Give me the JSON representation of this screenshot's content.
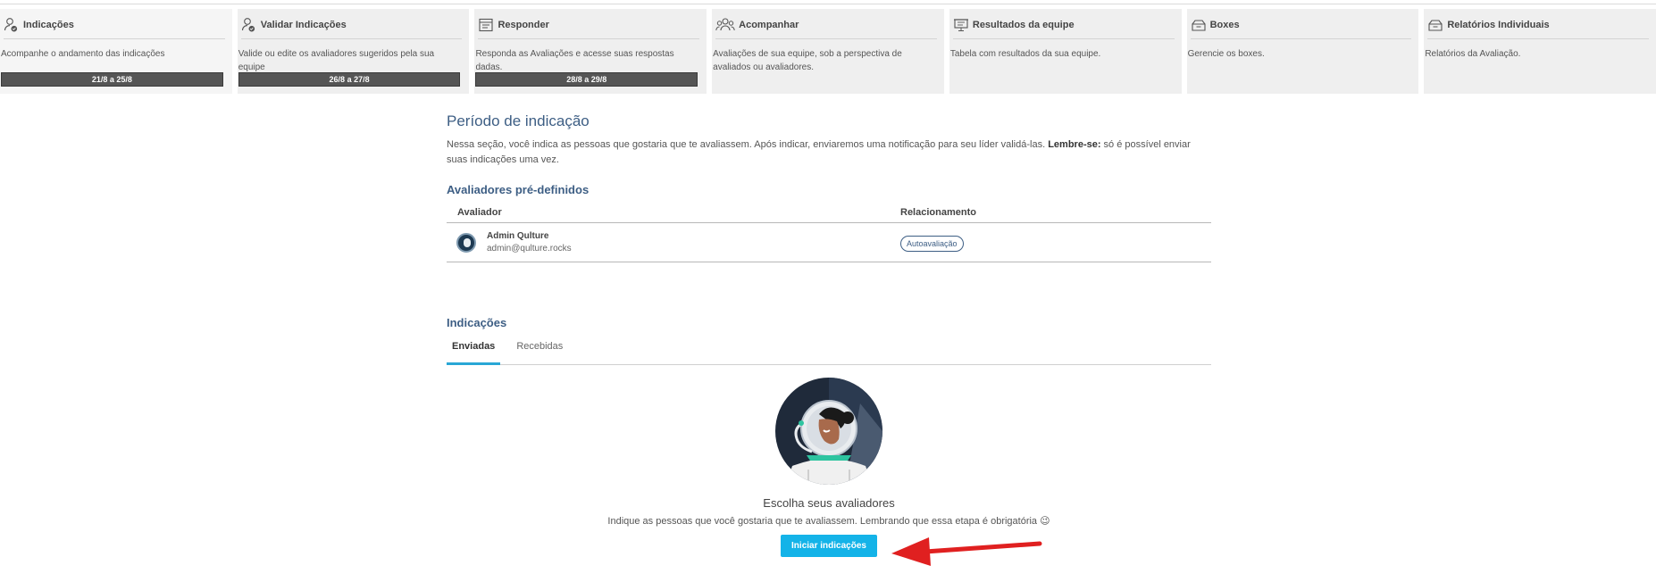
{
  "steps": [
    {
      "title": "Indicações",
      "desc": "Acompanhe o andamento das indicações",
      "date": "21/8 a 25/8",
      "icon": "person-check-icon"
    },
    {
      "title": "Validar Indicações",
      "desc": "Valide ou edite os avaliadores sugeridos pela sua equipe",
      "date": "26/8 a 27/8",
      "icon": "person-check-icon"
    },
    {
      "title": "Responder",
      "desc": "Responda as Avaliações e acesse suas respostas dadas.",
      "date": "28/8 a 29/8",
      "icon": "form-icon"
    },
    {
      "title": "Acompanhar",
      "desc": "Avaliações de sua equipe, sob a perspectiva de avaliados ou avaliadores.",
      "icon": "group-icon"
    },
    {
      "title": "Resultados da equipe",
      "desc": "Tabela com resultados da sua equipe.",
      "icon": "presentation-icon"
    },
    {
      "title": "Boxes",
      "desc": "Gerencie os boxes.",
      "icon": "box-icon"
    },
    {
      "title": "Relatórios Individuais",
      "desc": "Relatórios da Avaliação.",
      "icon": "box-icon"
    }
  ],
  "main": {
    "title": "Período de indicação",
    "intro_1": "Nessa seção, você indica as pessoas que gostaria que te avaliassem. Após indicar, enviaremos uma notificação para seu líder validá-las. ",
    "intro_bold": "Lembre-se:",
    "intro_2": " só é possível enviar suas indicações uma vez.",
    "predef_title": "Avaliadores pré-definidos",
    "table_headers": {
      "evaluator": "Avaliador",
      "relationship": "Relacionamento"
    },
    "rows": [
      {
        "name": "Admin Qulture",
        "email": "admin@qulture.rocks",
        "relationship": "Autoavaliação"
      }
    ],
    "indications_title": "Indicações",
    "tabs": {
      "sent": "Enviadas",
      "received": "Recebidas"
    },
    "empty": {
      "title": "Escolha seus avaliadores",
      "desc": "Indique as pessoas que você gostaria que te avaliassem. Lembrando que essa etapa é obrigatória 😉",
      "cta": "Iniciar indicações"
    }
  },
  "colors": {
    "accent": "#3d5e84",
    "cta": "#14b3e8",
    "tab_indicator": "#29a7d6",
    "arrow": "#e02020",
    "date_bar": "#555555"
  }
}
